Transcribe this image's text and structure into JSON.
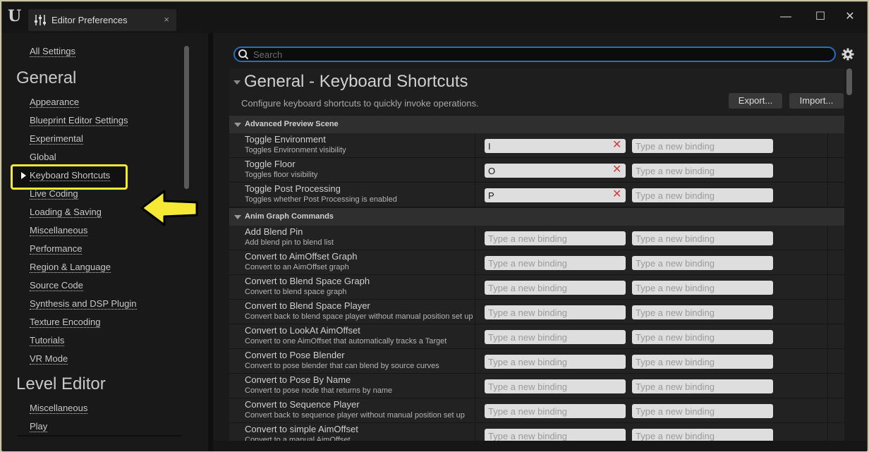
{
  "window": {
    "tab_title": "Editor Preferences",
    "tab_close": "×",
    "controls": {
      "minimize": "—",
      "maximize": "☐",
      "close": "✕"
    },
    "logo": "U"
  },
  "sidebar": {
    "all_settings": "All Settings",
    "groups": [
      {
        "header": "General",
        "items": [
          "Appearance",
          "Blueprint Editor Settings",
          "Experimental",
          "Global",
          "Keyboard Shortcuts",
          "Live Coding",
          "Loading & Saving",
          "Miscellaneous",
          "Performance",
          "Region & Language",
          "Source Code",
          "Synthesis and DSP Plugin",
          "Texture Encoding",
          "Tutorials",
          "VR Mode"
        ],
        "selected": "Keyboard Shortcuts"
      },
      {
        "header": "Level Editor",
        "items": [
          "Miscellaneous",
          "Play"
        ]
      }
    ],
    "highlight_color": "#f5e936"
  },
  "search": {
    "placeholder": "Search",
    "value": ""
  },
  "section": {
    "title": "General - Keyboard Shortcuts",
    "description": "Configure keyboard shortcuts to quickly invoke operations.",
    "export_label": "Export...",
    "import_label": "Import..."
  },
  "binding_placeholder": "Type a new binding",
  "categories": [
    {
      "label": "Advanced Preview Scene",
      "rows": [
        {
          "name": "Toggle Environment",
          "desc": "Toggles Environment visibility",
          "binding1": "I",
          "binding2": ""
        },
        {
          "name": "Toggle Floor",
          "desc": "Toggles floor visibility",
          "binding1": "O",
          "binding2": ""
        },
        {
          "name": "Toggle Post Processing",
          "desc": "Toggles whether Post Processing is enabled",
          "binding1": "P",
          "binding2": ""
        }
      ]
    },
    {
      "label": "Anim Graph Commands",
      "rows": [
        {
          "name": "Add Blend Pin",
          "desc": "Add blend pin to blend list",
          "binding1": "",
          "binding2": ""
        },
        {
          "name": "Convert to AimOffset Graph",
          "desc": "Convert to an AimOffset graph",
          "binding1": "",
          "binding2": ""
        },
        {
          "name": "Convert to Blend Space Graph",
          "desc": "Convert to blend space graph",
          "binding1": "",
          "binding2": ""
        },
        {
          "name": "Convert to Blend Space Player",
          "desc": "Convert back to blend space player without manual position set up",
          "binding1": "",
          "binding2": ""
        },
        {
          "name": "Convert to LookAt AimOffset",
          "desc": "Convert to one AimOffset that automatically tracks a Target",
          "binding1": "",
          "binding2": ""
        },
        {
          "name": "Convert to Pose Blender",
          "desc": "Convert to pose blender that can blend by source curves",
          "binding1": "",
          "binding2": ""
        },
        {
          "name": "Convert to Pose By Name",
          "desc": "Convert to pose node that returns by name",
          "binding1": "",
          "binding2": ""
        },
        {
          "name": "Convert to Sequence Player",
          "desc": "Convert back to sequence player without manual position set up",
          "binding1": "",
          "binding2": ""
        },
        {
          "name": "Convert to simple AimOffset",
          "desc": "Convert to a manual AimOffset",
          "binding1": "",
          "binding2": ""
        }
      ]
    }
  ],
  "colors": {
    "search_border": "#2a6fb8",
    "clear_x": "#d23c3c",
    "callout_arrow": "#f5e936"
  }
}
